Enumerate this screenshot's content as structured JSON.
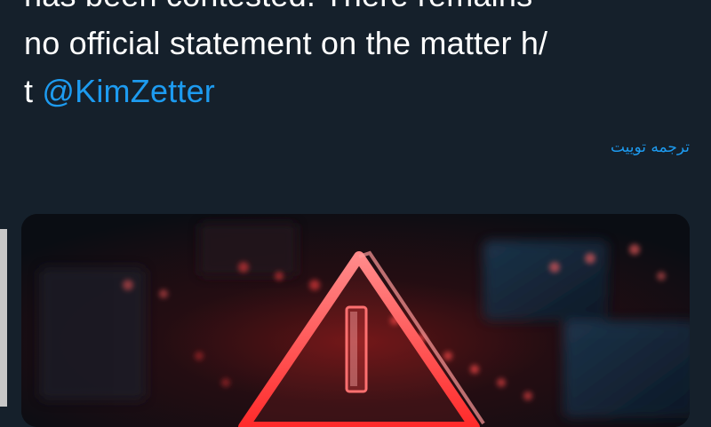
{
  "tweet": {
    "text_lines": [
      "has been contested. There remains",
      "no official statement on the matter h/"
    ],
    "last_line_prefix": "t ",
    "mention": "@KimZetter"
  },
  "translate_label": "ترجمه توییت",
  "media": {
    "icon": "warning-triangle-icon"
  },
  "colors": {
    "background": "#15202b",
    "accent": "#1d9bf0",
    "warning": "#ff4a4a"
  }
}
